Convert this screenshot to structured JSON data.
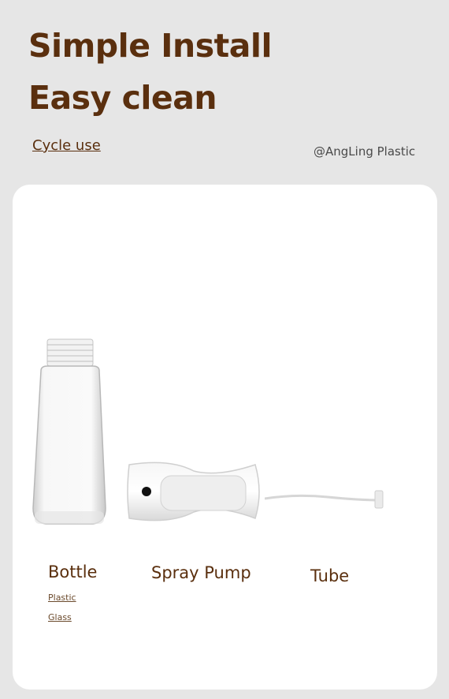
{
  "headline": {
    "line1": "Simple Install",
    "line2": "Easy clean"
  },
  "cycle_link": "Cycle use",
  "brand": "@AngLing Plastic",
  "parts": {
    "bottle": {
      "name": "Bottle",
      "materials": [
        "Plastic",
        "Glass"
      ]
    },
    "pump": {
      "name": "Spray Pump"
    },
    "tube": {
      "name": "Tube"
    }
  }
}
